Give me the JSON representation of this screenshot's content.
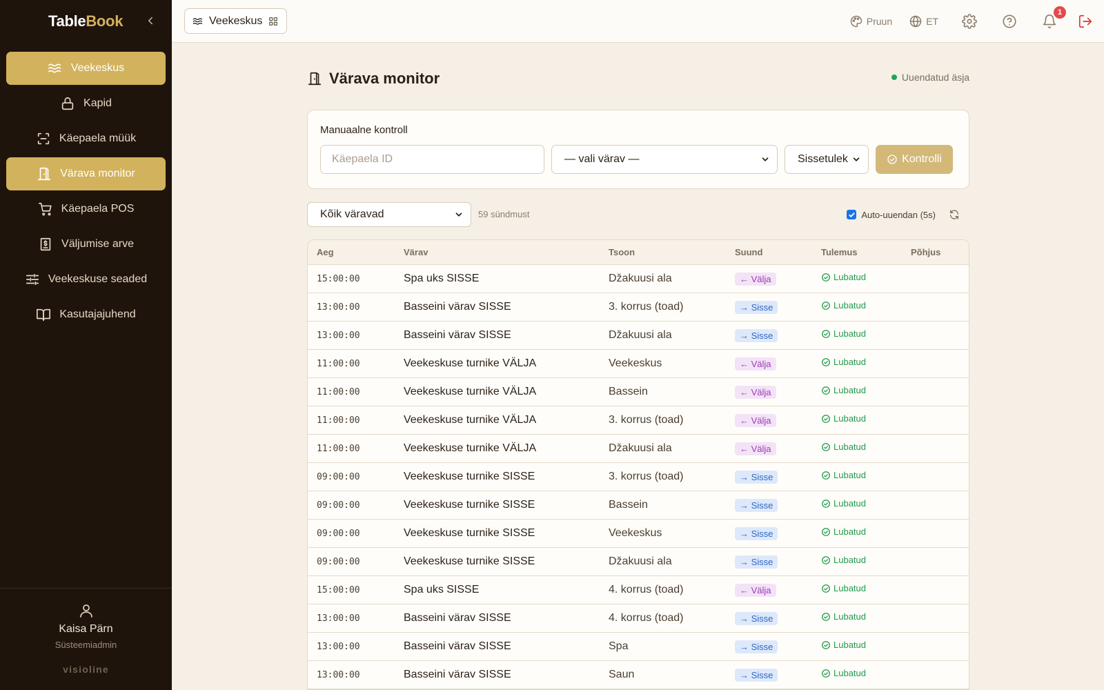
{
  "app": {
    "brand_part1": "Table",
    "brand_part2": "Book"
  },
  "sidebar": {
    "items": [
      {
        "label": "Veekeskus",
        "icon": "waves-icon",
        "active": true
      },
      {
        "label": "Kapid",
        "icon": "lock-icon",
        "active": false
      },
      {
        "label": "Käepaela müük",
        "icon": "scan-icon",
        "active": false
      },
      {
        "label": "Värava monitor",
        "icon": "door-icon",
        "active": true
      },
      {
        "label": "Käepaela POS",
        "icon": "cart-icon",
        "active": false
      },
      {
        "label": "Väljumise arve",
        "icon": "receipt-icon",
        "active": false
      },
      {
        "label": "Veekeskuse seaded",
        "icon": "sliders-icon",
        "active": false
      },
      {
        "label": "Kasutajajuhend",
        "icon": "book-icon",
        "active": false
      }
    ],
    "user": {
      "name": "Kaisa Pärn",
      "role": "Süsteemiadmin"
    },
    "footer_brand": "visioline"
  },
  "topbar": {
    "venue_label": "Veekeskus",
    "theme_label": "Pruun",
    "language_label": "ET",
    "notification_count": "1"
  },
  "page": {
    "title": "Värava monitor",
    "status_text": "Uuendatud äsja"
  },
  "manual_check": {
    "title": "Manuaalne kontroll",
    "wristband_placeholder": "Käepaela ID",
    "gate_select_value": "— vali värav —",
    "direction_select_value": "Sissetulek",
    "submit_label": "Kontrolli"
  },
  "filter": {
    "gate_filter_value": "Kõik väravad",
    "event_count": "59 sündmust",
    "auto_refresh_label": "Auto-uuendan (5s)",
    "auto_refresh_checked": true
  },
  "colors": {
    "accent": "#d2b25c",
    "sidebar_bg": "#1f140c",
    "page_bg": "#f5efe6",
    "in_badge": "#dde9fb",
    "out_badge": "#f3e3f7",
    "allowed": "#1f9a4b"
  },
  "table": {
    "columns": [
      "Aeg",
      "Värav",
      "Tsoon",
      "Suund",
      "Tulemus",
      "Põhjus"
    ],
    "rows": [
      {
        "time": "15:00:00",
        "gate": "Spa uks SISSE",
        "zone": "Džakuusi ala",
        "direction": "← Välja",
        "dir_type": "out",
        "result": "Lubatud",
        "reason": ""
      },
      {
        "time": "13:00:00",
        "gate": "Basseini värav SISSE",
        "zone": "3. korrus (toad)",
        "direction": "→ Sisse",
        "dir_type": "in",
        "result": "Lubatud",
        "reason": ""
      },
      {
        "time": "13:00:00",
        "gate": "Basseini värav SISSE",
        "zone": "Džakuusi ala",
        "direction": "→ Sisse",
        "dir_type": "in",
        "result": "Lubatud",
        "reason": ""
      },
      {
        "time": "11:00:00",
        "gate": "Veekeskuse turnike VÄLJA",
        "zone": "Veekeskus",
        "direction": "← Välja",
        "dir_type": "out",
        "result": "Lubatud",
        "reason": ""
      },
      {
        "time": "11:00:00",
        "gate": "Veekeskuse turnike VÄLJA",
        "zone": "Bassein",
        "direction": "← Välja",
        "dir_type": "out",
        "result": "Lubatud",
        "reason": ""
      },
      {
        "time": "11:00:00",
        "gate": "Veekeskuse turnike VÄLJA",
        "zone": "3. korrus (toad)",
        "direction": "← Välja",
        "dir_type": "out",
        "result": "Lubatud",
        "reason": ""
      },
      {
        "time": "11:00:00",
        "gate": "Veekeskuse turnike VÄLJA",
        "zone": "Džakuusi ala",
        "direction": "← Välja",
        "dir_type": "out",
        "result": "Lubatud",
        "reason": ""
      },
      {
        "time": "09:00:00",
        "gate": "Veekeskuse turnike SISSE",
        "zone": "3. korrus (toad)",
        "direction": "→ Sisse",
        "dir_type": "in",
        "result": "Lubatud",
        "reason": ""
      },
      {
        "time": "09:00:00",
        "gate": "Veekeskuse turnike SISSE",
        "zone": "Bassein",
        "direction": "→ Sisse",
        "dir_type": "in",
        "result": "Lubatud",
        "reason": ""
      },
      {
        "time": "09:00:00",
        "gate": "Veekeskuse turnike SISSE",
        "zone": "Veekeskus",
        "direction": "→ Sisse",
        "dir_type": "in",
        "result": "Lubatud",
        "reason": ""
      },
      {
        "time": "09:00:00",
        "gate": "Veekeskuse turnike SISSE",
        "zone": "Džakuusi ala",
        "direction": "→ Sisse",
        "dir_type": "in",
        "result": "Lubatud",
        "reason": ""
      },
      {
        "time": "15:00:00",
        "gate": "Spa uks SISSE",
        "zone": "4. korrus (toad)",
        "direction": "← Välja",
        "dir_type": "out",
        "result": "Lubatud",
        "reason": ""
      },
      {
        "time": "13:00:00",
        "gate": "Basseini värav SISSE",
        "zone": "4. korrus (toad)",
        "direction": "→ Sisse",
        "dir_type": "in",
        "result": "Lubatud",
        "reason": ""
      },
      {
        "time": "13:00:00",
        "gate": "Basseini värav SISSE",
        "zone": "Spa",
        "direction": "→ Sisse",
        "dir_type": "in",
        "result": "Lubatud",
        "reason": ""
      },
      {
        "time": "13:00:00",
        "gate": "Basseini värav SISSE",
        "zone": "Saun",
        "direction": "→ Sisse",
        "dir_type": "in",
        "result": "Lubatud",
        "reason": ""
      }
    ]
  }
}
